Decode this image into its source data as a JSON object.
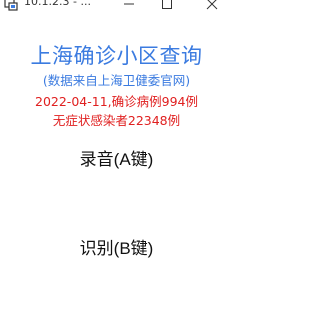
{
  "window": {
    "title": "10.1.2.3 - ...",
    "icon": "app-icon",
    "controls": [
      "minimize-icon",
      "maximize-icon",
      "close-icon"
    ]
  },
  "main": {
    "title": "上海确诊小区查询",
    "subtitle": "(数据来自上海卫健委官网)",
    "stats_line1": "2022-04-11,确诊病例994例",
    "stats_line2": "无症状感染者22348例"
  },
  "buttons": {
    "record_label": "录音(A键)",
    "recognize_label": "识别(B键)"
  },
  "colors": {
    "title": "#3b7be0",
    "stats": "#e02020",
    "button_text": "#111111"
  }
}
